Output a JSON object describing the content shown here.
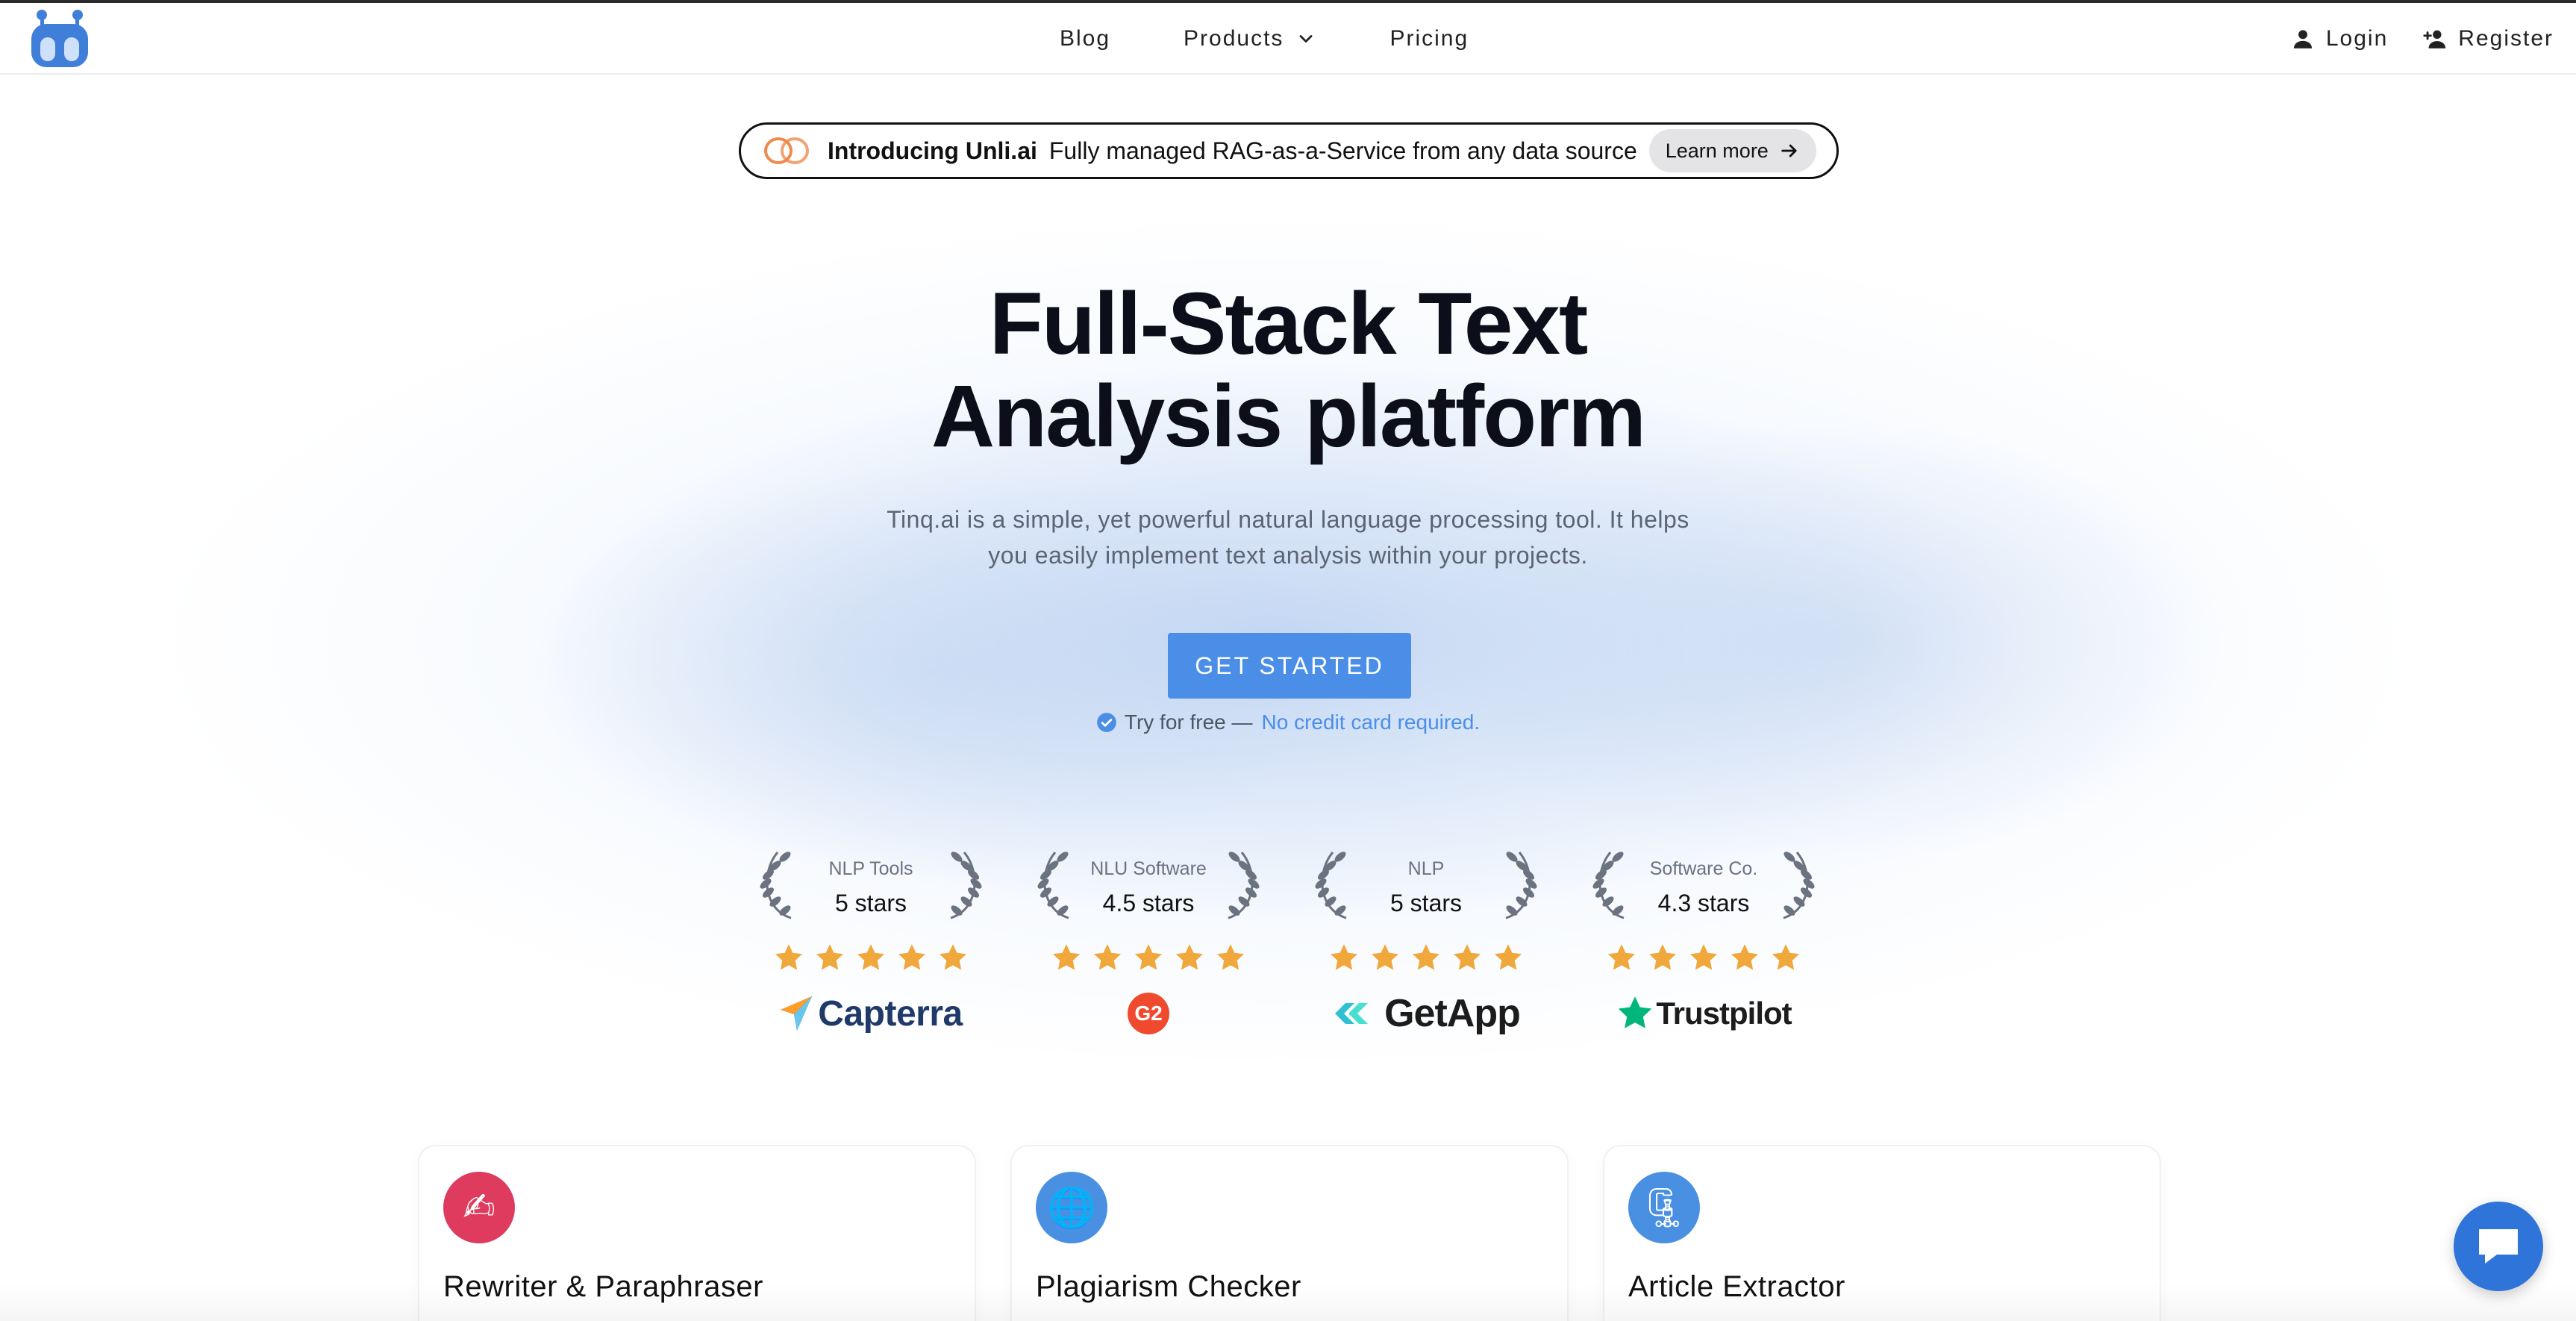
{
  "nav": {
    "blog": "Blog",
    "products": "Products",
    "pricing": "Pricing",
    "login": "Login",
    "register": "Register"
  },
  "banner": {
    "strong": "Introducing Unli.ai",
    "text": "Fully managed RAG-as-a-Service from any data source",
    "learn_more": "Learn more"
  },
  "hero": {
    "title_line1": "Full-Stack Text",
    "title_line2": "Analysis platform",
    "subtitle_line1": "Tinq.ai is a simple, yet powerful natural language processing tool. It helps",
    "subtitle_line2": "you easily implement text analysis within your projects.",
    "cta": "GET STARTED",
    "try_free": "Try for free —",
    "no_card": "No credit card required."
  },
  "awards": [
    {
      "category": "NLP Tools",
      "value": "5 stars",
      "stars": 5,
      "brand": "Capterra"
    },
    {
      "category": "NLU Software",
      "value": "4.5 stars",
      "stars": 5,
      "brand": "G2"
    },
    {
      "category": "NLP",
      "value": "5 stars",
      "stars": 5,
      "brand": "GetApp"
    },
    {
      "category": "Software Co.",
      "value": "4.3 stars",
      "stars": 5,
      "brand": "Trustpilot"
    }
  ],
  "cards": [
    {
      "title": "Rewriter & Paraphraser",
      "icon": "writing-hand-icon",
      "color": "#de3b5e"
    },
    {
      "title": "Plagiarism Checker",
      "icon": "globe-icon",
      "color": "#4a90e2"
    },
    {
      "title": "Article Extractor",
      "icon": "zipper-icon",
      "color": "#4a90e2"
    }
  ],
  "colors": {
    "accent": "#4a8ee8",
    "star": "#f0a83c",
    "chat": "#2f74d8"
  }
}
